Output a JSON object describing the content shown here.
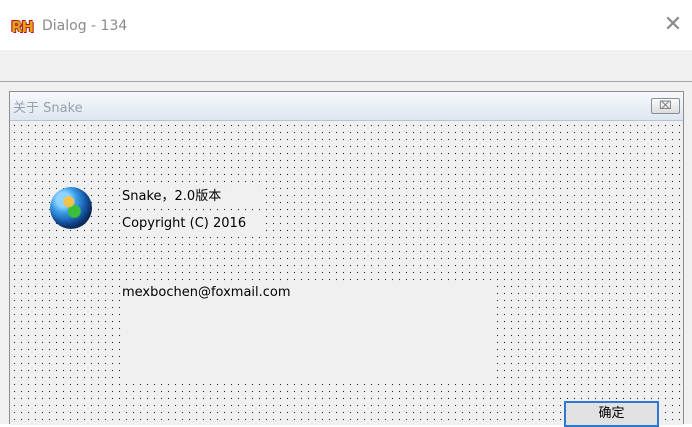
{
  "window": {
    "logo": "RH",
    "title": "Dialog - 134",
    "close_glyph": "✕"
  },
  "dialog": {
    "title": "关于 Snake",
    "close_glyph": "⌧",
    "version_text": "Snake，2.0版本",
    "copyright_text": "Copyright (C) 2016",
    "email_text": "mexbochen@foxmail.com",
    "ok_label": "确定",
    "icon": "globe-icon"
  }
}
